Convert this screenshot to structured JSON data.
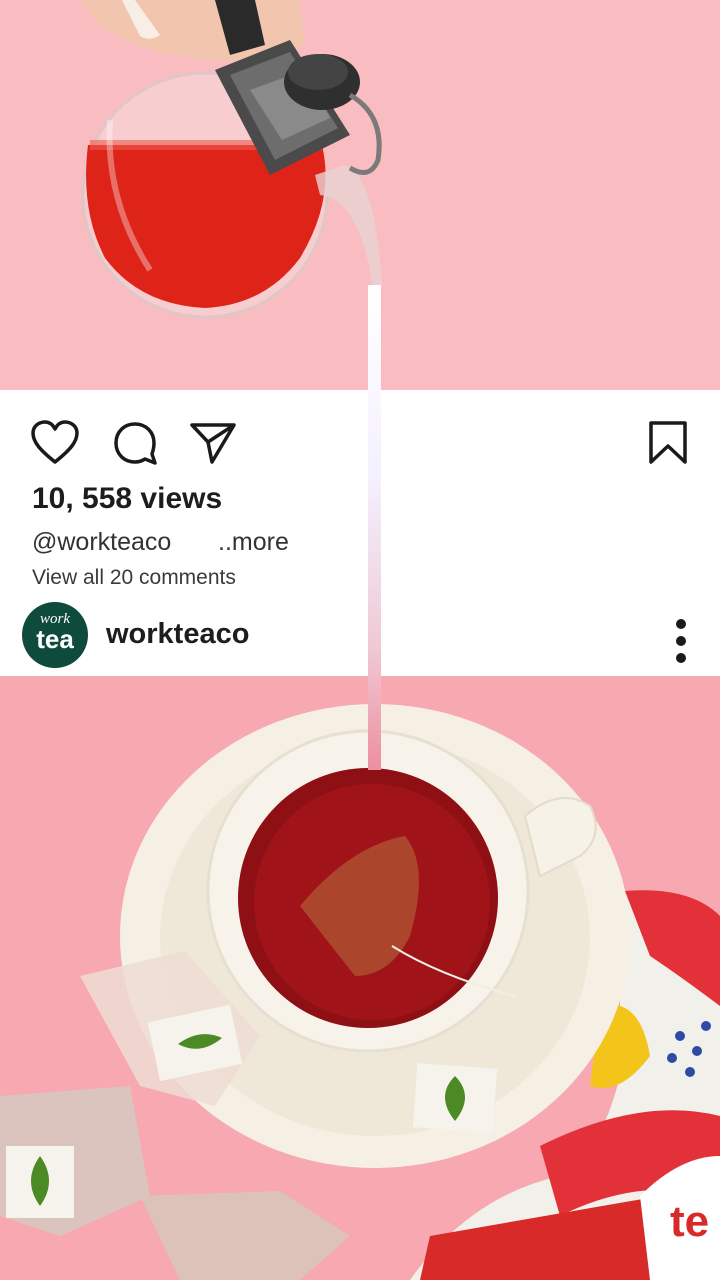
{
  "post": {
    "views": "10, 558 views",
    "handle": "@workteaco",
    "more_label": "..more",
    "comments_link": "View all 20 comments",
    "username": "workteaco",
    "avatar": {
      "text_top": "work",
      "text_bottom": "tea"
    }
  },
  "icons": {
    "like": "heart-icon",
    "comment": "comment-bubble-icon",
    "share": "send-icon",
    "save": "bookmark-icon",
    "options": "more-vertical-icon"
  },
  "colors": {
    "background_pink": "#f9bcc0",
    "tea_red": "#d8241c",
    "avatar_green": "#0f4b3c",
    "card_white": "#ffffff"
  }
}
